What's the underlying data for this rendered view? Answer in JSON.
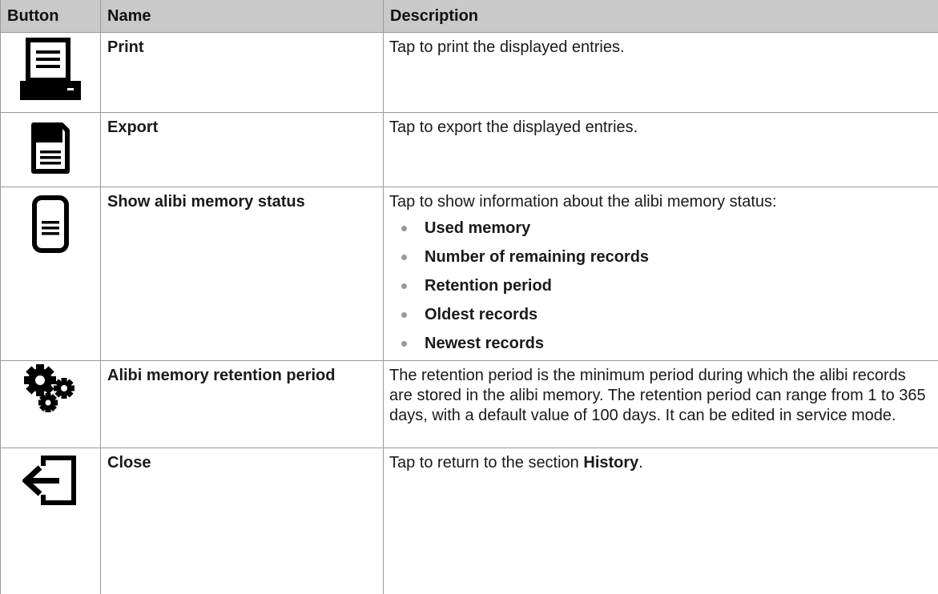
{
  "header": {
    "button": "Button",
    "name": "Name",
    "description": "Description"
  },
  "rows": [
    {
      "icon": "printer-icon",
      "name": "Print",
      "description": "Tap to print the displayed entries."
    },
    {
      "icon": "floppy-disk-icon",
      "name": "Export",
      "description": "Tap to export the displayed entries."
    },
    {
      "icon": "memory-status-icon",
      "name": "Show alibi memory status",
      "description": "Tap to show information about the alibi memory status:",
      "bullets": [
        "Used memory",
        "Number of remaining records",
        "Retention period",
        "Oldest records",
        "Newest records"
      ]
    },
    {
      "icon": "gears-icon",
      "name": "Alibi memory retention period",
      "description": "The retention period is the minimum period during which the alibi records are stored in the alibi memory. The retention period can range from 1 to 365 days, with a default value of 100 days. It can be edited in service mode."
    },
    {
      "icon": "exit-arrow-icon",
      "name": "Close",
      "description_prefix": "Tap to return to the section ",
      "description_bold": "History",
      "description_suffix": "."
    }
  ]
}
